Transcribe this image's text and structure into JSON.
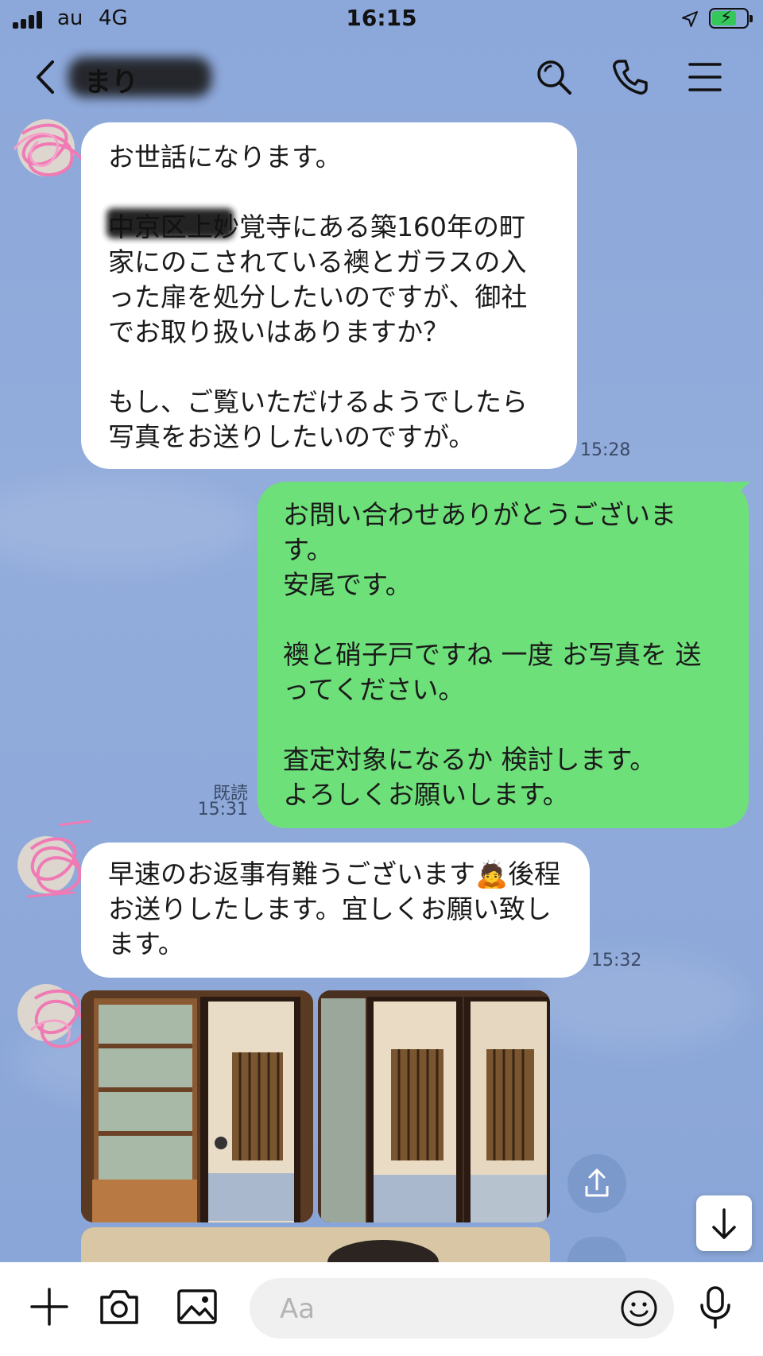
{
  "status_bar": {
    "carrier": "au",
    "network": "4G",
    "time": "16:15"
  },
  "header": {
    "contact_name": "まり"
  },
  "messages": [
    {
      "id": "m1",
      "direction": "incoming",
      "text": "お世話になります。\n\n中京区上妙覚寺にある築160年の町家にのこされている襖とガラスの入った扉を処分したいのですが、御社でお取り扱いはありますか？\n\nもし、ご覧いただけるようでしたら写真をお送りしたいのですが。",
      "time": "15:28"
    },
    {
      "id": "m2",
      "direction": "outgoing",
      "text": "お問い合わせありがとうございます。\n安尾です。\n\n襖と硝子戸ですね 一度 お写真を 送ってください。\n\n査定対象になるか 検討します。\nよろしくお願いします。",
      "read_label": "既読",
      "time": "15:31"
    },
    {
      "id": "m3",
      "direction": "incoming",
      "text": "早速のお返事有難うございます🙇後程お送りしたします。宜しくお願い致します。",
      "time": "15:32"
    }
  ],
  "input": {
    "placeholder": "Aa"
  },
  "icons": {
    "back": "chevron-left-icon",
    "search": "search-icon",
    "call": "phone-icon",
    "menu": "hamburger-menu-icon",
    "plus": "plus-icon",
    "camera": "camera-icon",
    "image": "image-icon",
    "emoji": "smiley-icon",
    "mic": "microphone-icon",
    "share": "share-icon",
    "scroll_down": "arrow-down-icon"
  },
  "colors": {
    "chat_bg": "#8fa9d9",
    "incoming_bubble": "#ffffff",
    "outgoing_bubble": "#6ee07a"
  }
}
